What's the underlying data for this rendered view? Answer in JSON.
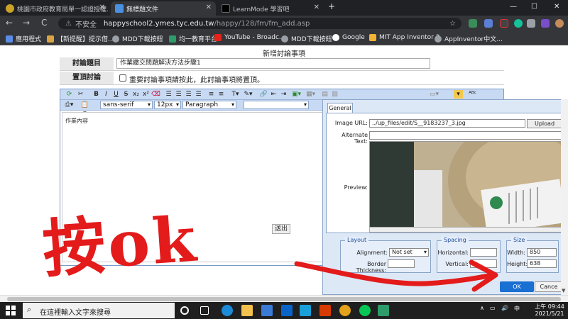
{
  "browser": {
    "tabs": [
      {
        "label": "桃園市政府教育局單一認證授權..."
      },
      {
        "label": "無標題文件"
      },
      {
        "label": "LearnMode 學習吧"
      }
    ],
    "nav": {
      "back": "←",
      "forward": "→",
      "reload": "C"
    },
    "omnibox": {
      "security": "不安全",
      "host": "happyschool2.ymes.tyc.edu.tw",
      "path": "/happy/128/fm/fm_add.asp"
    },
    "bookmarks": [
      {
        "label": "應用程式"
      },
      {
        "label": "【新提醒】提示借..."
      },
      {
        "label": "MDD下載按鈕"
      },
      {
        "label": "均一教育平台"
      },
      {
        "label": "YouTube - Broadc..."
      },
      {
        "label": "MDD下載按鈕"
      },
      {
        "label": "Google"
      },
      {
        "label": "MIT App Inventor 2"
      },
      {
        "label": "AppInventor中文..."
      }
    ],
    "window_controls": {
      "minimize": "—",
      "maximize": "☐",
      "close": "✕"
    }
  },
  "page": {
    "title": "新增討論事項",
    "topic": {
      "label": "討論題目",
      "value": "作業繳交問題解決方法步驟1"
    },
    "pin": {
      "label": "置頂討論",
      "checkbox_text": "重要討論事項請按此，此討論事項將置頂。"
    },
    "editor": {
      "font_family": "sans-serif",
      "font_size": "12px",
      "block_format": "Paragraph",
      "content": "作業內容",
      "bold": "B",
      "italic": "I",
      "underline": "U",
      "strike": "S",
      "subscript": "x₂",
      "superscript": "x²"
    },
    "exit_button": "送出"
  },
  "dialog": {
    "tab": "General",
    "image_url": {
      "label": "Image URL:",
      "value": "../up_files/edit/S__9183237_3.jpg"
    },
    "upload_button": "Upload",
    "alt_text": {
      "label": "Alternate Text:",
      "value": ""
    },
    "preview_label": "Preview:",
    "layout": {
      "legend": "Layout",
      "alignment_label": "Alignment:",
      "alignment_value": "Not set",
      "border_label": "Border Thickness:",
      "border_value": ""
    },
    "spacing": {
      "legend": "Spacing",
      "horizontal_label": "Horizontal:",
      "horizontal_value": "",
      "vertical_label": "Vertical:",
      "vertical_value": ""
    },
    "size": {
      "legend": "Size",
      "width_label": "Width:",
      "width_value": "850",
      "height_label": "Height:",
      "height_value": "638"
    },
    "ok_button": "OK",
    "cancel_button": "Cance"
  },
  "annotation": {
    "text": "按ok",
    "color": "#e31b1b"
  },
  "taskbar": {
    "search_placeholder": "在這裡輸入文字來搜尋",
    "tray_ime": "中",
    "time": "上午 09:44",
    "date": "2021/5/21"
  },
  "colors": {
    "chrome_dark": "#202124",
    "editor_toolbar": "#c8daf3",
    "dialog_bg": "#dde8f7",
    "ok_blue": "#1a6fd3"
  }
}
